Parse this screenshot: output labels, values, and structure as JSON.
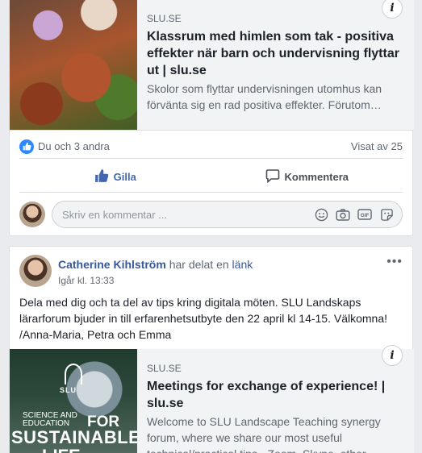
{
  "post1": {
    "preview": {
      "domain": "SLU.SE",
      "title": "Klassrum med himlen som tak - positiva effekter när barn och undervisning flyttar ut | slu.se",
      "description": "Skolor som flyttar undervisningen utomhus kan förvänta sig en rad positiva effekter. Förutom…",
      "info_label": "i"
    },
    "reactions": {
      "likes_text": "Du och 3 andra",
      "views_text": "Visat av 25"
    },
    "actions": {
      "like_label": "Gilla",
      "comment_label": "Kommentera"
    },
    "comment_box": {
      "placeholder": "Skriv en kommentar ..."
    }
  },
  "post2": {
    "author": "Catherine Kihlström",
    "shared_text": "har delat en",
    "link_text": "länk",
    "timestamp": "Igår kl. 13:33",
    "more_label": "•••",
    "body": "Dela med dig och ta del av tips kring digitala möten. SLU Landskaps lärarforum bjuder in till erfarenhetsutbyte den 22 april kl 14-15. Välkomna! /Anna-Maria, Petra och Emma",
    "preview": {
      "domain": "SLU.SE",
      "title": "Meetings for exchange of experience! | slu.se",
      "description": "Welcome to SLU Landscape Teaching synergy forum, where we share our most useful technical/practical tips - Zoom, Skype, other…",
      "info_label": "i",
      "image_text": {
        "logo": "SLU",
        "line1": "SCIENCE AND",
        "line2": "EDUCATION",
        "for": "FOR",
        "sustainable": "SUSTAINABLE",
        "life": "LIFE"
      }
    }
  },
  "colors": {
    "link_blue": "#385898",
    "like_blue": "#4267b2",
    "background": "#e9ebee"
  }
}
